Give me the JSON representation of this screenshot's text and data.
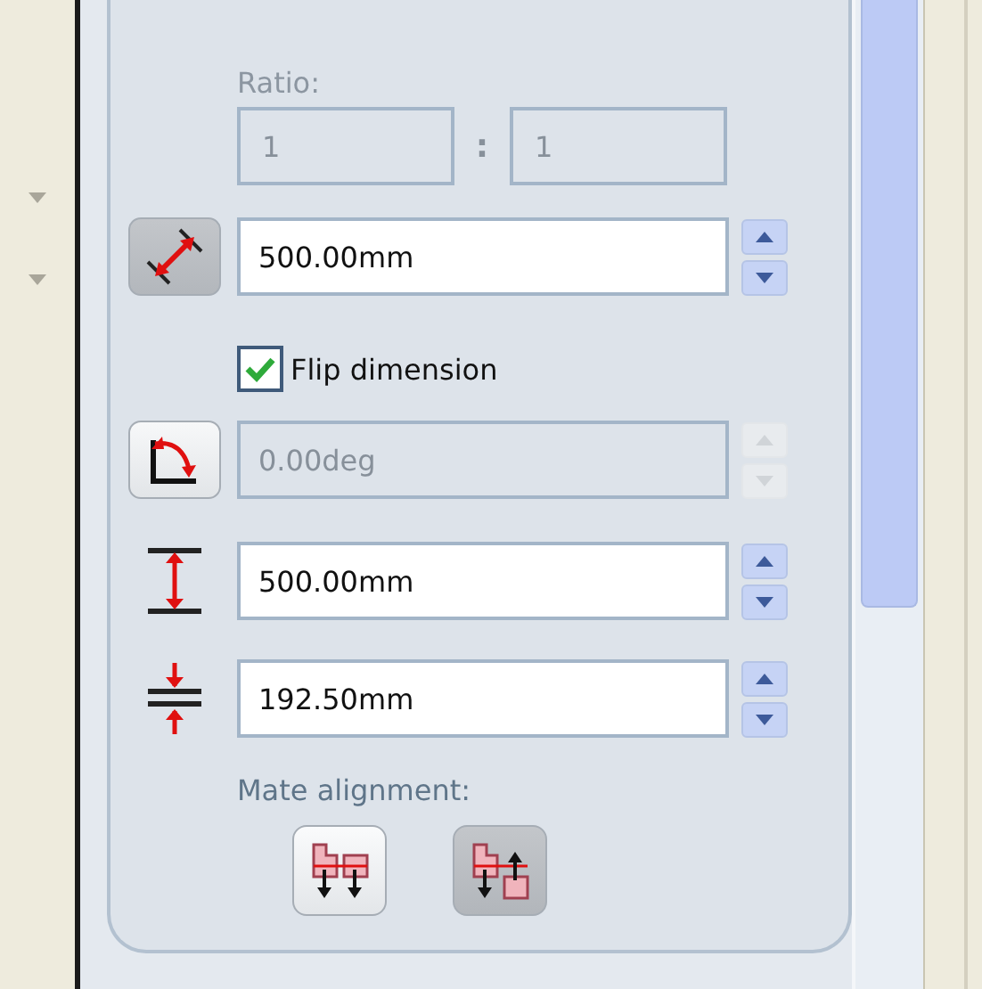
{
  "ratio": {
    "label": "Ratio:",
    "disabled": true,
    "values": [
      "1",
      "1"
    ],
    "separator": ":"
  },
  "items": [
    {
      "kind": "spin",
      "framed": true,
      "pressed": true,
      "value": "500.00mm",
      "disabled": false
    },
    {
      "kind": "check",
      "label": "Flip dimension",
      "checked": true
    },
    {
      "kind": "spin",
      "framed": true,
      "pressed": false,
      "value": "0.00deg",
      "disabled": true
    },
    {
      "kind": "spin",
      "framed": false,
      "value": "500.00mm",
      "disabled": false
    },
    {
      "kind": "spin",
      "framed": false,
      "value": "192.50mm",
      "disabled": false
    }
  ],
  "mate": {
    "label": "Mate alignment:",
    "options": [
      {
        "selected": false
      },
      {
        "selected": true
      }
    ]
  }
}
